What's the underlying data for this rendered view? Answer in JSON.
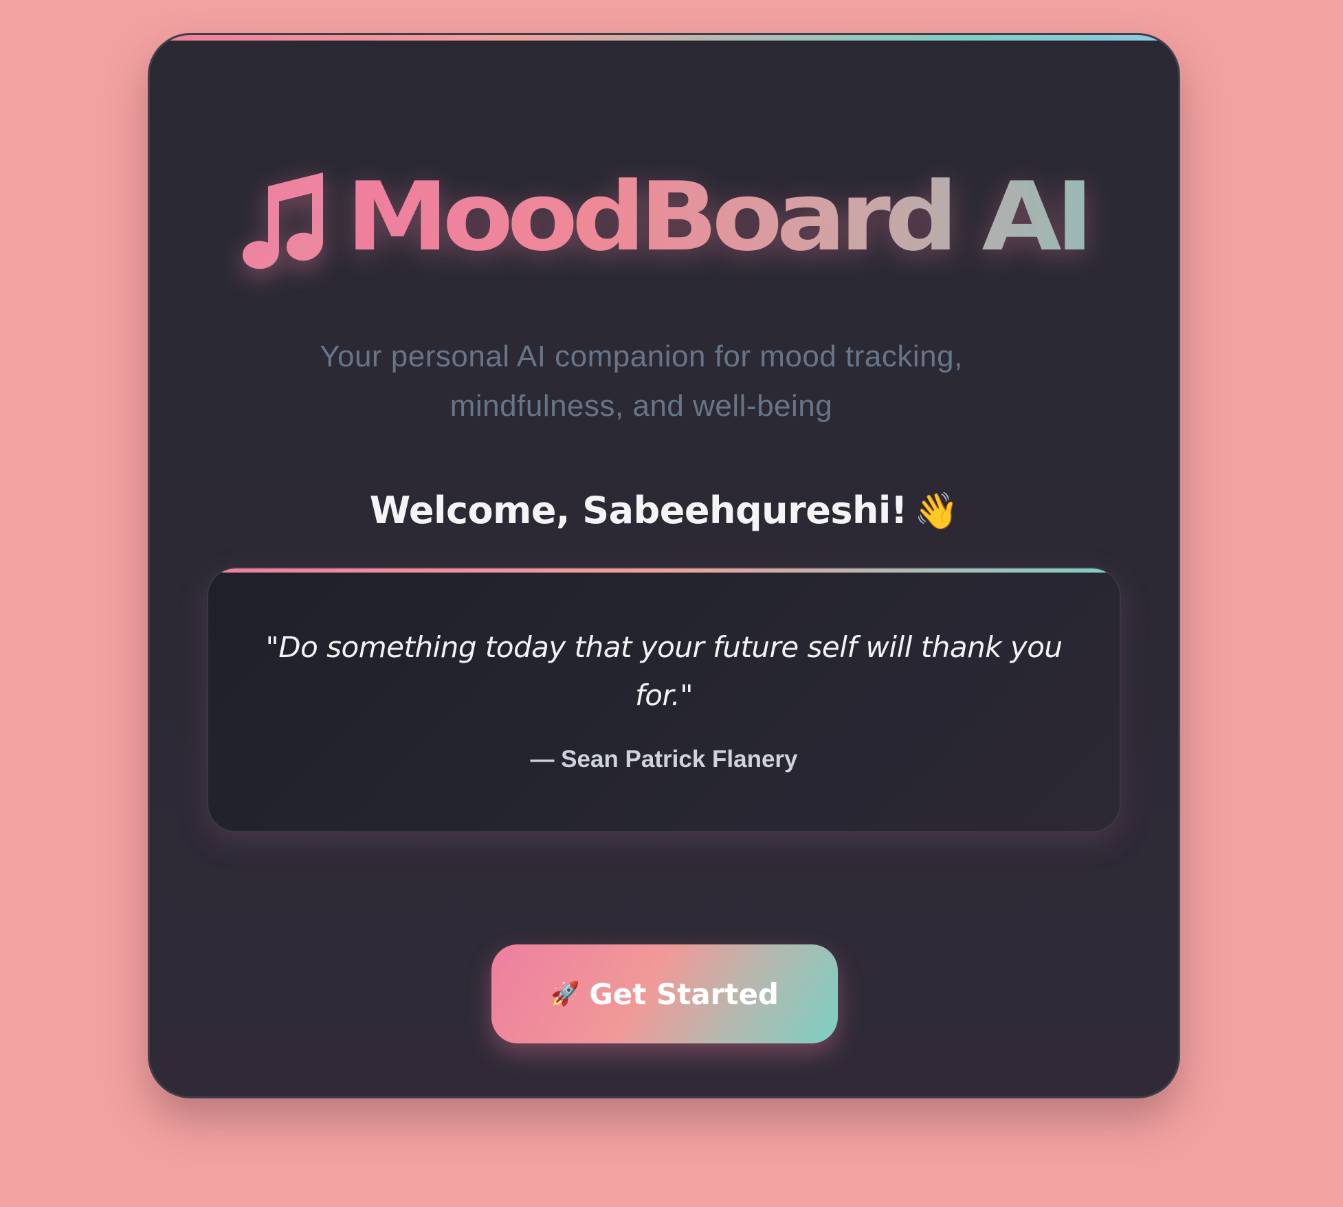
{
  "app": {
    "logo_icon": "music-note-icon",
    "logo_text": "MoodBoard AI",
    "tagline_line1": "Your personal AI companion for mood tracking,",
    "tagline_line2": "mindfulness, and well-being"
  },
  "welcome": {
    "text": "Welcome, Sabeehqureshi!",
    "emoji": "👋"
  },
  "quote": {
    "text": "\"Do something today that your future self will thank you for.\"",
    "author": "— Sean Patrick Flanery"
  },
  "cta": {
    "icon": "🚀",
    "label": "Get Started"
  },
  "colors": {
    "background": "#f2a2a0",
    "card": "#2a2933",
    "accent_pink": "#ee7f9f",
    "accent_teal": "#7ccfc3",
    "tagline": "#687588"
  }
}
